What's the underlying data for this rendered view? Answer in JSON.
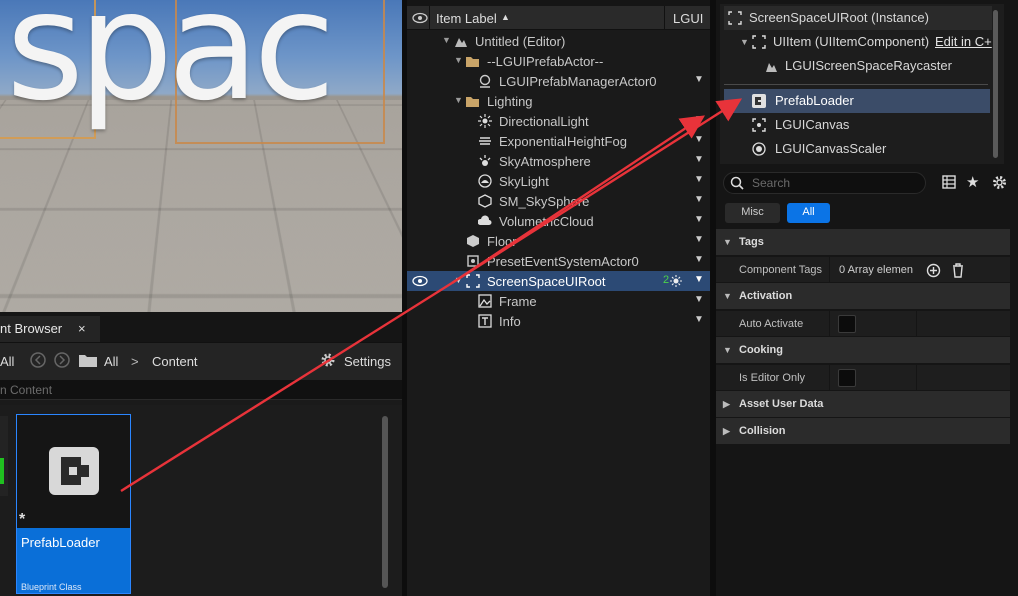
{
  "viewport": {
    "scene_text": "spac"
  },
  "content_browser": {
    "tab_title": "nt Browser",
    "close": "×",
    "toolbar": {
      "all_left": "All",
      "path_root": "All",
      "sep": ">",
      "path_content": "Content",
      "settings": "Settings"
    },
    "search_placeholder": "n Content",
    "asset": {
      "name": "PrefabLoader",
      "type": "Blueprint Class",
      "star": "*"
    }
  },
  "outliner": {
    "header": {
      "item_label": "Item Label",
      "sort": "▲",
      "column2": "LGUI"
    },
    "rows": [
      {
        "label": "Untitled (Editor)"
      },
      {
        "label": "--LGUIPrefabActor--"
      },
      {
        "label": "LGUIPrefabManagerActor0"
      },
      {
        "label": "Lighting"
      },
      {
        "label": "DirectionalLight"
      },
      {
        "label": "ExponentialHeightFog"
      },
      {
        "label": "SkyAtmosphere"
      },
      {
        "label": "SkyLight"
      },
      {
        "label": "SM_SkySphere"
      },
      {
        "label": "VolumetricCloud"
      },
      {
        "label": "Floor"
      },
      {
        "label": "PresetEventSystemActor0"
      },
      {
        "label": "ScreenSpaceUIRoot",
        "badge": "2"
      },
      {
        "label": "Frame"
      },
      {
        "label": "Info"
      }
    ]
  },
  "details": {
    "components": [
      {
        "label": "ScreenSpaceUIRoot (Instance)"
      },
      {
        "label": "UIItem (UIItemComponent)",
        "link": "Edit in C+"
      },
      {
        "label": "LGUIScreenSpaceRaycaster"
      },
      {
        "label": "PrefabLoader"
      },
      {
        "label": "LGUICanvas"
      },
      {
        "label": "LGUICanvasScaler"
      }
    ],
    "search_placeholder": "Search",
    "filters": {
      "misc": "Misc",
      "all": "All"
    },
    "categories": {
      "tags": "Tags",
      "component_tags_label": "Component Tags",
      "component_tags_value": "0 Array elemen",
      "activation": "Activation",
      "auto_activate": "Auto Activate",
      "cooking": "Cooking",
      "is_editor_only": "Is Editor Only",
      "asset_user_data": "Asset User Data",
      "collision": "Collision"
    }
  },
  "colors": {
    "accent": "#0a6fd8",
    "selection": "#2c4a75",
    "arrow": "#e8333a"
  }
}
